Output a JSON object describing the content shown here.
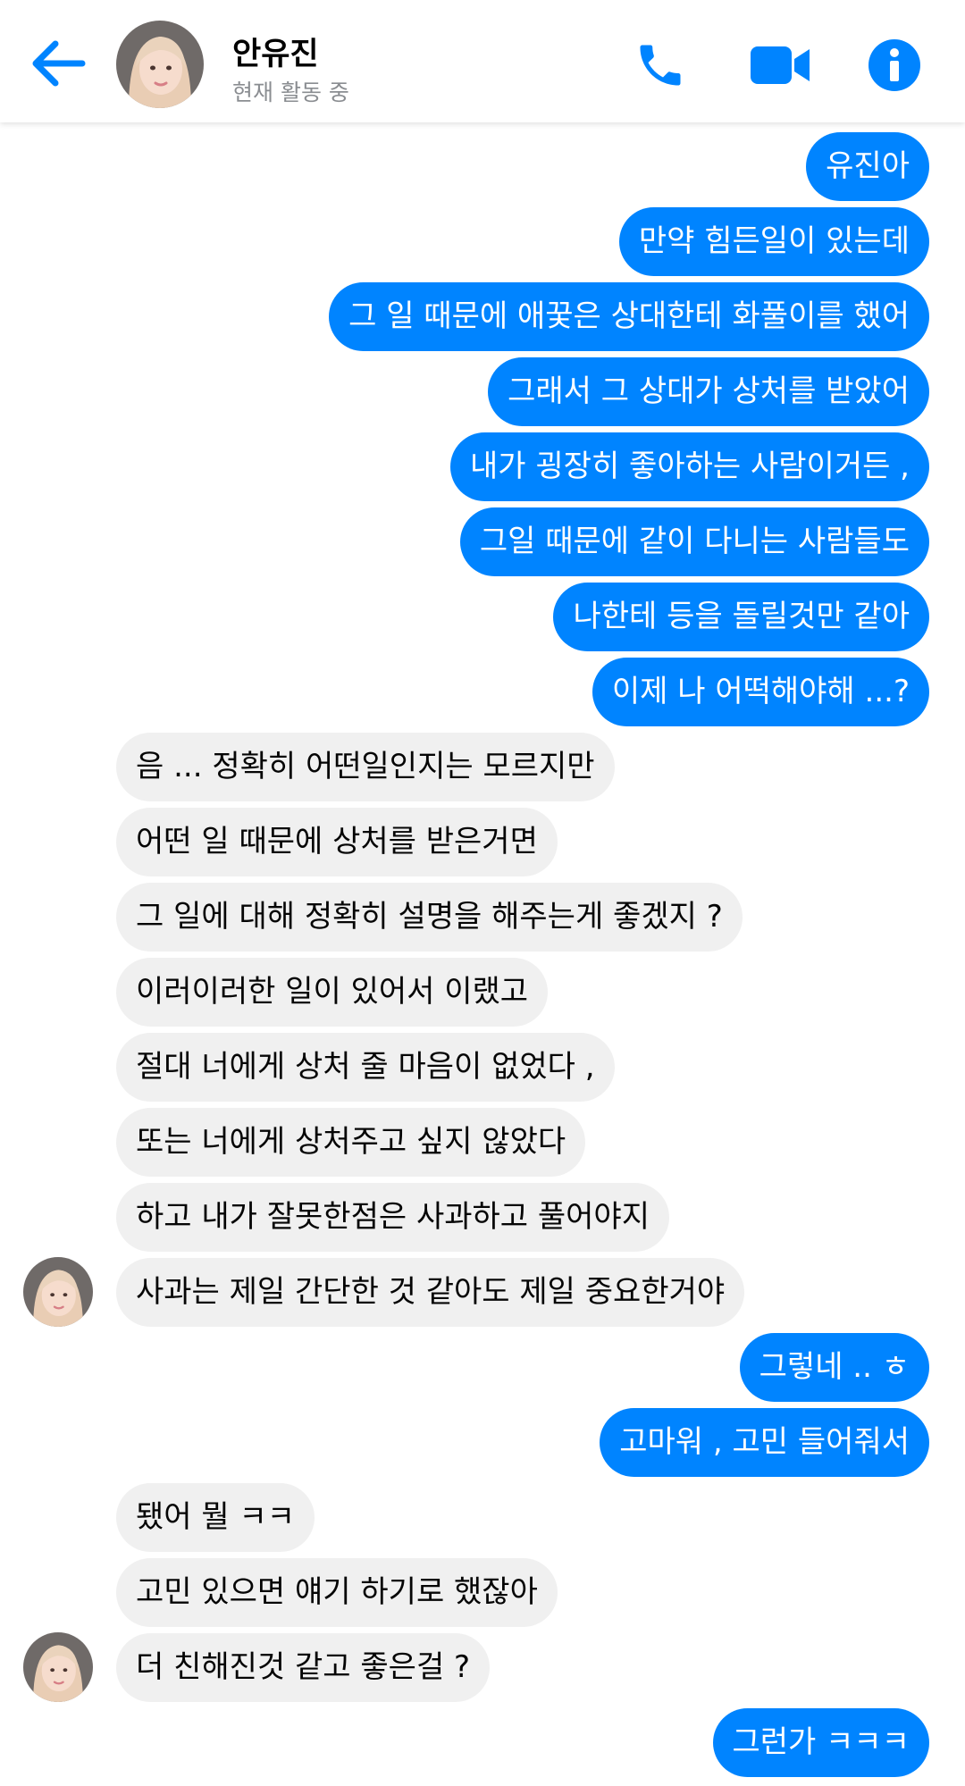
{
  "header": {
    "contact_name": "안유진",
    "status": "현재 활동 중",
    "accent_color": "#0084ff",
    "icons": [
      "back-arrow-icon",
      "phone-icon",
      "video-camera-icon",
      "info-icon"
    ]
  },
  "messages": [
    {
      "from": "me",
      "text": "유진아"
    },
    {
      "from": "me",
      "text": "만약 힘든일이 있는데"
    },
    {
      "from": "me",
      "text": "그 일 때문에 애꿎은 상대한테 화풀이를 했어"
    },
    {
      "from": "me",
      "text": "그래서 그 상대가 상처를 받았어"
    },
    {
      "from": "me",
      "text": "내가 굉장히 좋아하는 사람이거든 ,"
    },
    {
      "from": "me",
      "text": "그일 때문에 같이 다니는 사람들도"
    },
    {
      "from": "me",
      "text": "나한테 등을 돌릴것만 같아"
    },
    {
      "from": "me",
      "text": "이제 나 어떡해야해 ...?"
    },
    {
      "from": "them",
      "text": "음 ... 정확히 어떤일인지는 모르지만"
    },
    {
      "from": "them",
      "text": "어떤 일 때문에 상처를 받은거면"
    },
    {
      "from": "them",
      "text": "그 일에 대해 정확히 설명을 해주는게 좋겠지 ?"
    },
    {
      "from": "them",
      "text": "이러이러한 일이 있어서 이랬고"
    },
    {
      "from": "them",
      "text": "절대 너에게 상처 줄 마음이 없었다 ,"
    },
    {
      "from": "them",
      "text": "또는 너에게 상처주고 싶지 않았다"
    },
    {
      "from": "them",
      "text": "하고 내가 잘못한점은 사과하고 풀어야지"
    },
    {
      "from": "them",
      "text": "사과는 제일 간단한 것 같아도 제일 중요한거야"
    },
    {
      "from": "me",
      "text": "그렇네 .. ㅎ"
    },
    {
      "from": "me",
      "text": "고마워 , 고민 들어줘서"
    },
    {
      "from": "them",
      "text": "됐어 뭘 ㅋㅋ"
    },
    {
      "from": "them",
      "text": "고민 있으면 얘기 하기로 했잖아"
    },
    {
      "from": "them",
      "text": "더 친해진것 같고 좋은걸 ?"
    },
    {
      "from": "me",
      "text": "그런가 ㅋㅋㅋ"
    }
  ]
}
